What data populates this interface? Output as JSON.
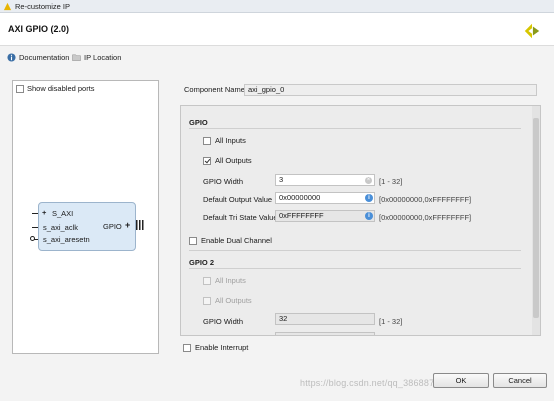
{
  "window": {
    "title": "Re-customize IP"
  },
  "header": {
    "ip_title": "AXI GPIO (2.0)"
  },
  "toolbar": {
    "documentation": "Documentation",
    "ip_location": "IP Location"
  },
  "left_panel": {
    "show_disabled_label": "Show disabled ports",
    "block": {
      "s_axi": "S_AXI",
      "s_axi_aclk": "s_axi_aclk",
      "s_axi_aresetn": "s_axi_aresetn",
      "gpio": "GPIO"
    }
  },
  "component": {
    "label": "Component Name",
    "value": "axi_gpio_0"
  },
  "gpio": {
    "title": "GPIO",
    "all_inputs": "All Inputs",
    "all_outputs": "All Outputs",
    "width_label": "GPIO Width",
    "width_value": "3",
    "width_range": "[1 - 32]",
    "default_output_label": "Default Output Value",
    "default_output_value": "0x00000000",
    "default_output_range": "[0x00000000,0xFFFFFFFF]",
    "default_tri_label": "Default Tri State Value",
    "default_tri_value": "0xFFFFFFFF",
    "default_tri_range": "[0x00000000,0xFFFFFFFF]",
    "dual_channel": "Enable Dual Channel"
  },
  "gpio2": {
    "title": "GPIO 2",
    "all_inputs": "All Inputs",
    "all_outputs": "All Outputs",
    "width_label": "GPIO Width",
    "width_value": "32",
    "width_range": "[1 - 32]"
  },
  "enable_interrupt": "Enable Interrupt",
  "buttons": {
    "ok": "OK",
    "cancel": "Cancel"
  },
  "watermark": "https://blog.csdn.net/qq_38688710",
  "colors": {
    "block_fill": "#dbe9f6",
    "info_icon": "#4a8fd8",
    "logo": "#d7c600"
  }
}
